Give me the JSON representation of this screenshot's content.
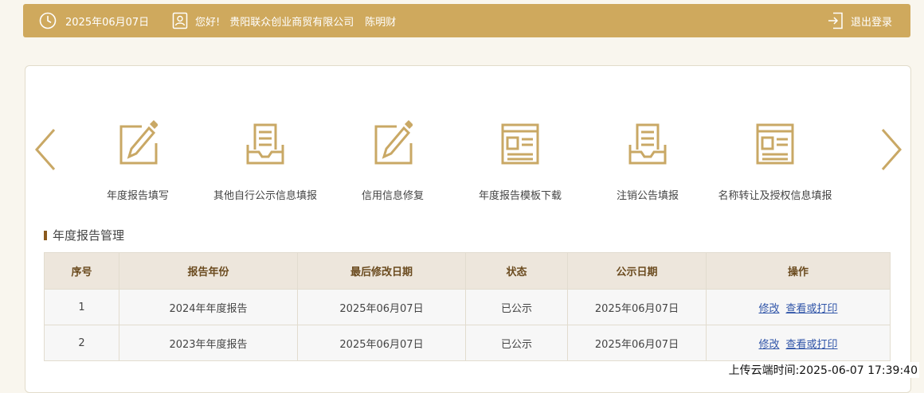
{
  "header": {
    "date": "2025年06月07日",
    "greeting": "您好!",
    "company": "贵阳联众创业商贸有限公司",
    "user": "陈明财",
    "logout": "退出登录"
  },
  "tiles": [
    {
      "label": "年度报告填写",
      "icon": "edit-icon"
    },
    {
      "label": "其他自行公示信息填报",
      "icon": "inbox-document-icon"
    },
    {
      "label": "信用信息修复",
      "icon": "edit-icon"
    },
    {
      "label": "年度报告模板下载",
      "icon": "template-window-icon"
    },
    {
      "label": "注销公告填报",
      "icon": "inbox-document-icon"
    },
    {
      "label": "名称转让及授权信息填报",
      "icon": "template-window-icon"
    }
  ],
  "section": {
    "title": "年度报告管理"
  },
  "table": {
    "headers": [
      "序号",
      "报告年份",
      "最后修改日期",
      "状态",
      "公示日期",
      "操作"
    ],
    "rows": [
      {
        "no": "1",
        "year": "2024年年度报告",
        "modified": "2025年06月07日",
        "status": "已公示",
        "published": "2025年06月07日",
        "edit": "修改",
        "view": "查看或打印"
      },
      {
        "no": "2",
        "year": "2023年年度报告",
        "modified": "2025年06月07日",
        "status": "已公示",
        "published": "2025年06月07日",
        "edit": "修改",
        "view": "查看或打印"
      }
    ]
  },
  "footer": {
    "upload_time": "上传云端时间:2025-06-07 17:39:40"
  },
  "colors": {
    "brand": "#cfa95d",
    "header_text": "#6b4b1f",
    "link": "#2f54a8"
  }
}
